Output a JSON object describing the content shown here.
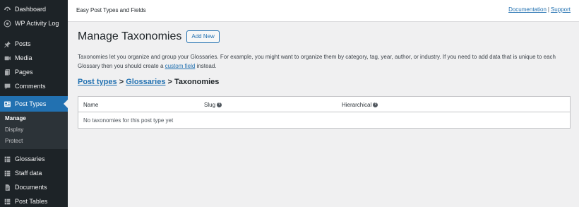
{
  "sidebar": {
    "items_top": [
      {
        "label": "Dashboard",
        "icon": "dashboard-icon"
      },
      {
        "label": "WP Activity Log",
        "icon": "activity-log-icon"
      }
    ],
    "items_mid": [
      {
        "label": "Posts",
        "icon": "pin-icon"
      },
      {
        "label": "Media",
        "icon": "media-icon"
      },
      {
        "label": "Pages",
        "icon": "pages-icon"
      },
      {
        "label": "Comments",
        "icon": "comments-icon"
      }
    ],
    "active": {
      "label": "Post Types",
      "icon": "post-types-icon"
    },
    "submenu": [
      {
        "label": "Manage",
        "current": true
      },
      {
        "label": "Display",
        "current": false
      },
      {
        "label": "Protect",
        "current": false
      }
    ],
    "items_bottom": [
      {
        "label": "Glossaries",
        "icon": "table-icon"
      },
      {
        "label": "Staff data",
        "icon": "table-icon"
      },
      {
        "label": "Documents",
        "icon": "document-icon"
      },
      {
        "label": "Post Tables",
        "icon": "table-icon"
      }
    ]
  },
  "header": {
    "plugin_title": "Easy Post Types and Fields",
    "documentation_link": "Documentation",
    "separator": "|",
    "support_link": "Support"
  },
  "main": {
    "title": "Manage Taxonomies",
    "add_new_label": "Add New",
    "description_before": "Taxonomies let you organize and group your Glossaries. For example, you might want to organize them by category, tag, year, author, or industry. If you need to add data that is unique to each Glossary then you should create a ",
    "description_link": "custom field",
    "description_after": " instead.",
    "breadcrumb": {
      "post_types": "Post types",
      "glossaries": "Glossaries",
      "current": "Taxonomies",
      "separator": ">"
    },
    "table": {
      "columns": [
        "Name",
        "Slug",
        "Hierarchical"
      ],
      "empty_message": "No taxonomies for this post type yet"
    }
  },
  "colors": {
    "sidebar_bg": "#1d2327",
    "accent": "#2271b1",
    "page_bg": "#f0f0f1"
  }
}
